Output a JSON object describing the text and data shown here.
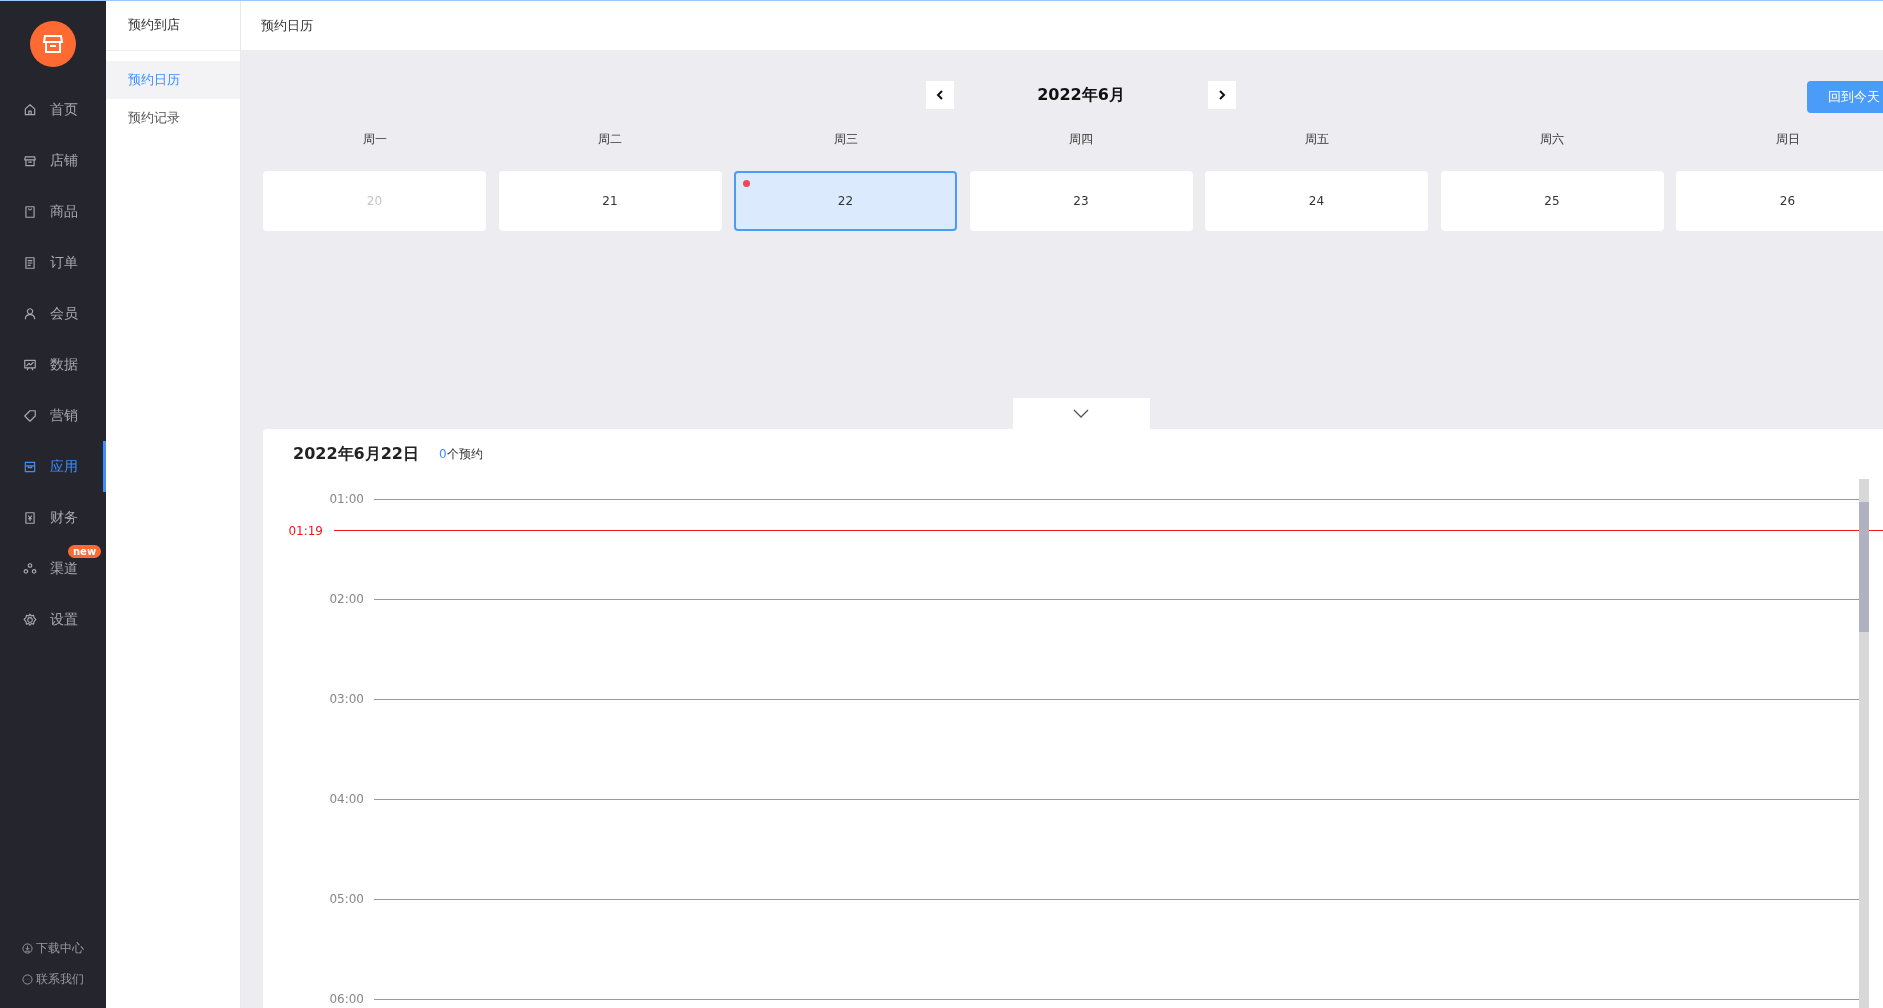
{
  "nav": {
    "items": [
      {
        "label": "首页",
        "selected": false
      },
      {
        "label": "店铺",
        "selected": false
      },
      {
        "label": "商品",
        "selected": false
      },
      {
        "label": "订单",
        "selected": false
      },
      {
        "label": "会员",
        "selected": false
      },
      {
        "label": "数据",
        "selected": false
      },
      {
        "label": "营销",
        "selected": false
      },
      {
        "label": "应用",
        "selected": true
      },
      {
        "label": "财务",
        "selected": false
      },
      {
        "label": "渠道",
        "selected": false,
        "badge": "new"
      },
      {
        "label": "设置",
        "selected": false
      }
    ],
    "footer": [
      "下载中心",
      "联系我们"
    ]
  },
  "submenu": {
    "title": "预约到店",
    "items": [
      {
        "label": "预约日历",
        "selected": true
      },
      {
        "label": "预约记录",
        "selected": false
      }
    ]
  },
  "header": {
    "title": "预约日历"
  },
  "calendar": {
    "title": "2022年6月",
    "today_button": "回到今天",
    "weekdays": [
      "周一",
      "周二",
      "周三",
      "周四",
      "周五",
      "周六",
      "周日"
    ],
    "days": [
      {
        "label": "20",
        "disabled": true,
        "selected": false,
        "marked": false
      },
      {
        "label": "21",
        "disabled": false,
        "selected": false,
        "marked": false
      },
      {
        "label": "22",
        "disabled": false,
        "selected": true,
        "marked": true
      },
      {
        "label": "23",
        "disabled": false,
        "selected": false,
        "marked": false
      },
      {
        "label": "24",
        "disabled": false,
        "selected": false,
        "marked": false
      },
      {
        "label": "25",
        "disabled": false,
        "selected": false,
        "marked": false
      },
      {
        "label": "26",
        "disabled": false,
        "selected": false,
        "marked": false
      }
    ]
  },
  "day_panel": {
    "title": "2022年6月22日",
    "count": "0",
    "count_label": "个预约",
    "hours": [
      "01:00",
      "02:00",
      "03:00",
      "04:00",
      "05:00",
      "06:00"
    ],
    "now": "01:19"
  }
}
